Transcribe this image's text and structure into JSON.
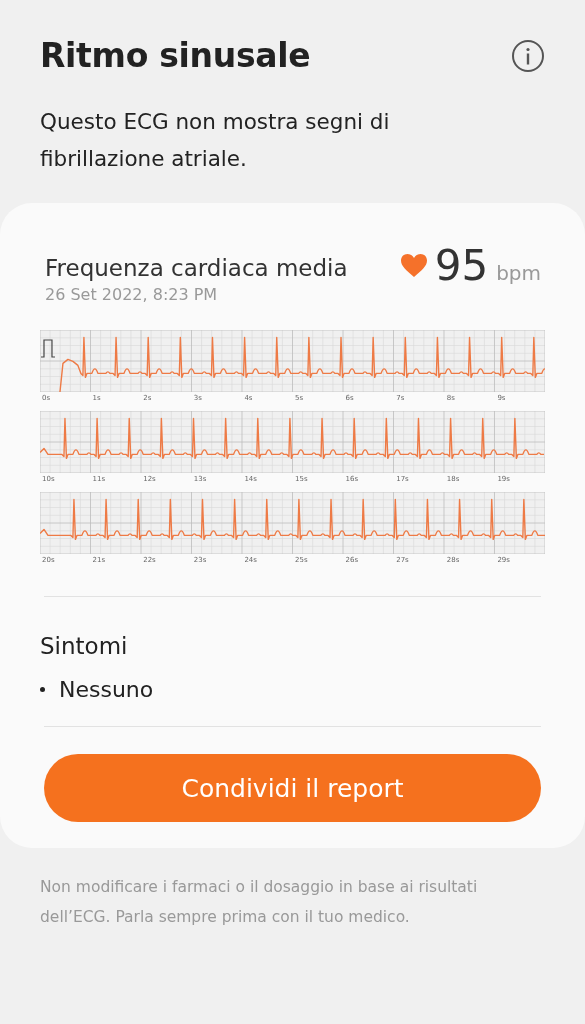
{
  "header": {
    "title": "Ritmo sinusale",
    "description": "Questo ECG non mostra segni di fibrillazione atriale."
  },
  "card": {
    "heart_rate": {
      "label": "Frequenza cardiaca media",
      "timestamp": "26 Set 2022, 8:23 PM",
      "value": "95",
      "unit": "bpm"
    },
    "strips": [
      {
        "calibration": true,
        "ticks": [
          "0s",
          "1s",
          "2s",
          "3s",
          "4s",
          "5s",
          "6s",
          "7s",
          "8s",
          "9s"
        ]
      },
      {
        "calibration": false,
        "ticks": [
          "10s",
          "11s",
          "12s",
          "13s",
          "14s",
          "15s",
          "16s",
          "17s",
          "18s",
          "19s"
        ]
      },
      {
        "calibration": false,
        "ticks": [
          "20s",
          "21s",
          "22s",
          "23s",
          "24s",
          "25s",
          "26s",
          "27s",
          "28s",
          "29s"
        ]
      }
    ],
    "symptoms": {
      "title": "Sintomi",
      "items": [
        "Nessuno"
      ]
    },
    "share_button": "Condividi il report"
  },
  "footer": "Non modificare i farmaci o il dosaggio in base ai risultati dell’ECG. Parla sempre prima con il tuo medico."
}
